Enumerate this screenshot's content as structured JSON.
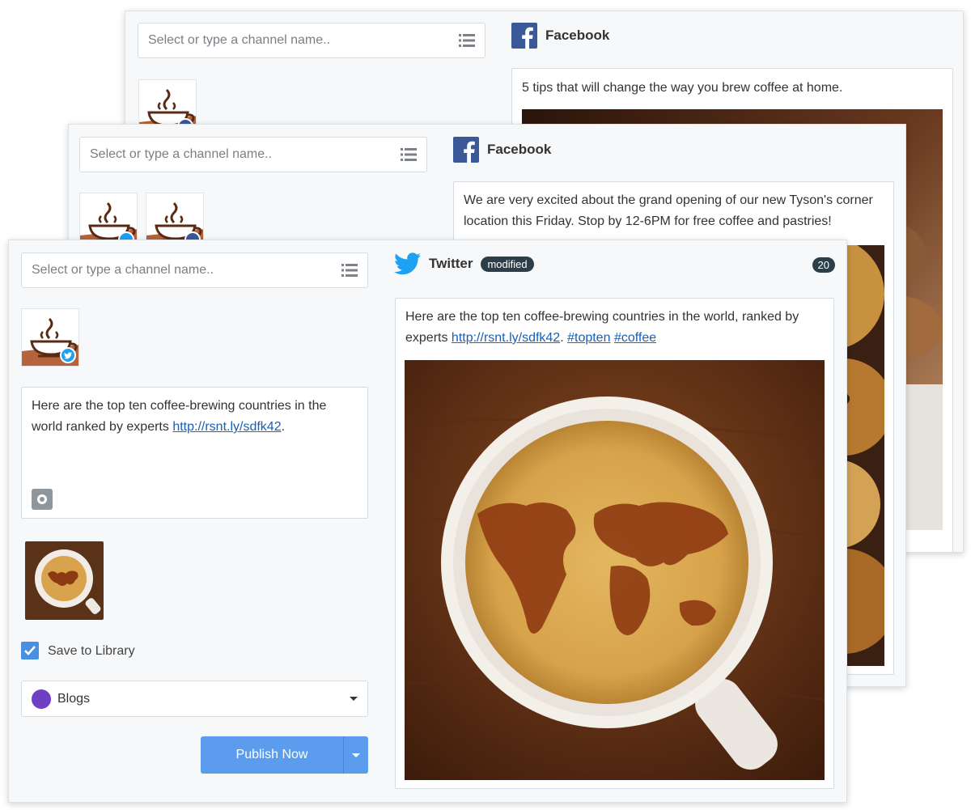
{
  "composer": {
    "channel_placeholder": "Select or type a channel name.."
  },
  "back_card": {
    "network_name": "Facebook",
    "post_text": "5 tips that will change the way you brew coffee at home."
  },
  "mid_card": {
    "network_name": "Facebook",
    "post_text": "We are very excited about the grand opening of our new Tyson's corner location this Friday. Stop by 12-6PM for free coffee and pastries!"
  },
  "front_card": {
    "editor_text": "Here are the top ten coffee-brewing countries in the world ranked by experts ",
    "editor_link": "http://rsnt.ly/sdfk42",
    "editor_after_link": ".",
    "save_to_library_label": "Save to Library",
    "category_label": "Blogs",
    "category_color": "#6f3fc4",
    "publish_label": "Publish Now",
    "preview": {
      "network_name": "Twitter",
      "modified_label": "modified",
      "char_count": "20",
      "text_before": "Here are the top ten coffee-brewing countries in the world, ranked by experts ",
      "link": "http://rsnt.ly/sdfk42",
      "text_mid": ". ",
      "hashtag1": "#topten",
      "hashtag2": "#coffee"
    }
  },
  "colors": {
    "facebook": "#3b5998",
    "twitter": "#1da1f2",
    "accent_button": "#5b9cee",
    "badge_dark": "#2d3e48"
  }
}
